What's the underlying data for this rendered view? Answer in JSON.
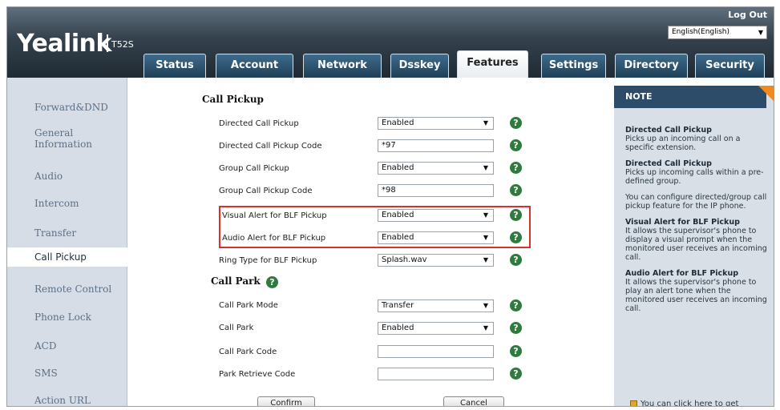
{
  "header": {
    "logo": "Yealink",
    "model": "T52S",
    "logout": "Log Out",
    "language": "English(English)"
  },
  "tabs": [
    {
      "label": "Status"
    },
    {
      "label": "Account"
    },
    {
      "label": "Network"
    },
    {
      "label": "Dsskey"
    },
    {
      "label": "Features"
    },
    {
      "label": "Settings"
    },
    {
      "label": "Directory"
    },
    {
      "label": "Security"
    }
  ],
  "sidebar": {
    "items": [
      {
        "label": "Forward&DND"
      },
      {
        "label": "General Information"
      },
      {
        "label": "Audio"
      },
      {
        "label": "Intercom"
      },
      {
        "label": "Transfer"
      },
      {
        "label": "Call Pickup"
      },
      {
        "label": "Remote Control"
      },
      {
        "label": "Phone Lock"
      },
      {
        "label": "ACD"
      },
      {
        "label": "SMS"
      },
      {
        "label": "Action URL"
      }
    ]
  },
  "main": {
    "call_pickup_title": "Call Pickup",
    "call_park_title": "Call Park",
    "pickup_rows": [
      {
        "label": "Directed Call Pickup",
        "value": "Enabled",
        "dropdown": true
      },
      {
        "label": "Directed Call Pickup Code",
        "value": "*97",
        "dropdown": false
      },
      {
        "label": "Group Call Pickup",
        "value": "Enabled",
        "dropdown": true
      },
      {
        "label": "Group Call Pickup Code",
        "value": "*98",
        "dropdown": false
      },
      {
        "label": "Visual Alert for BLF Pickup",
        "value": "Enabled",
        "dropdown": true
      },
      {
        "label": "Audio Alert for BLF Pickup",
        "value": "Enabled",
        "dropdown": true
      },
      {
        "label": "Ring Type for BLF Pickup",
        "value": "Splash.wav",
        "dropdown": true
      }
    ],
    "park_rows": [
      {
        "label": "Call Park Mode",
        "value": "Transfer",
        "dropdown": true
      },
      {
        "label": "Call Park",
        "value": "Enabled",
        "dropdown": true
      },
      {
        "label": "Call Park Code",
        "value": "",
        "dropdown": false
      },
      {
        "label": "Park Retrieve Code",
        "value": "",
        "dropdown": false
      }
    ],
    "confirm_label": "Confirm",
    "cancel_label": "Cancel",
    "help_glyph": "?"
  },
  "note": {
    "title": "NOTE",
    "entries": [
      {
        "heading": "Directed Call Pickup",
        "text": "Picks up an incoming call on a specific extension."
      },
      {
        "heading": "Directed Call Pickup",
        "text": "Picks up incoming calls within a pre-defined group."
      },
      {
        "heading": "",
        "text": "You can configure directed/group call pickup feature for the IP phone."
      },
      {
        "heading": "Visual Alert for BLF Pickup",
        "text": "It allows the supervisor's phone to display a visual prompt when the monitored user receives an incoming call."
      },
      {
        "heading": "Audio Alert for BLF Pickup",
        "text": "It allows the supervisor's phone to play an alert tone when the monitored user receives an incoming call."
      }
    ],
    "footer": "You can click here to get"
  },
  "colors": {
    "accent": "#2d4c6a",
    "highlight": "#d6312f",
    "help": "#2f7a3e",
    "note_corner": "#ef8a1f"
  }
}
